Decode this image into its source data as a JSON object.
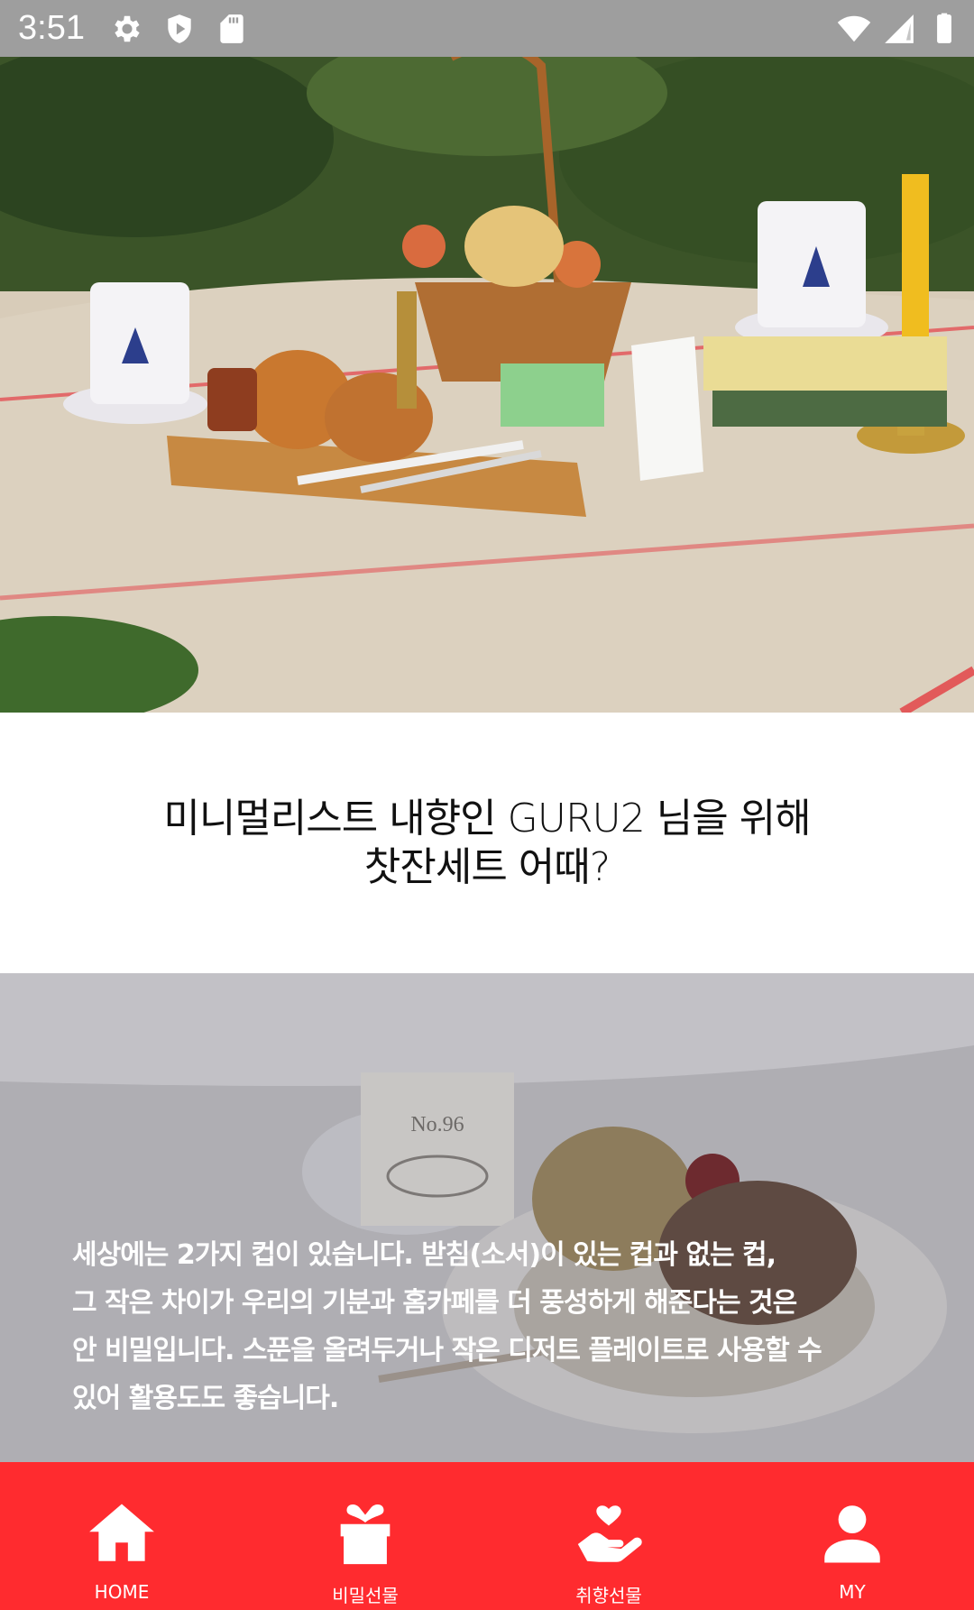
{
  "status_bar": {
    "time": "3:51",
    "left_icons": [
      "settings-icon",
      "play-protect-icon",
      "sd-card-icon"
    ],
    "right_icons": [
      "wifi-icon",
      "cell-signal-icon",
      "battery-icon"
    ]
  },
  "hero": {
    "image": "picnic-tea-set-photo"
  },
  "caption": {
    "line1": "미니멀리스트 내향인 GURU2 님을 위해",
    "line2": "찻잔세트 어때?"
  },
  "detail": {
    "image": "teacup-dessert-photo",
    "lines": [
      "세상에는 2가지 컵이 있습니다. 받침(소서)이 있는 컵과 없는 컵,",
      "그 작은 차이가 우리의 기분과 홈카페를 더 풍성하게 해준다는 것은",
      "안 비밀입니다. 스푼을 올려두거나 작은 디저트 플레이트로 사용할 수",
      "있어 활용도도 좋습니다."
    ]
  },
  "bottom_nav": {
    "background": "#ff2b2f",
    "items": [
      {
        "label": "HOME",
        "icon": "home-icon"
      },
      {
        "label": "비밀선물",
        "icon": "gift-icon"
      },
      {
        "label": "취향선물",
        "icon": "hand-heart-icon"
      },
      {
        "label": "MY",
        "icon": "person-icon"
      }
    ]
  }
}
